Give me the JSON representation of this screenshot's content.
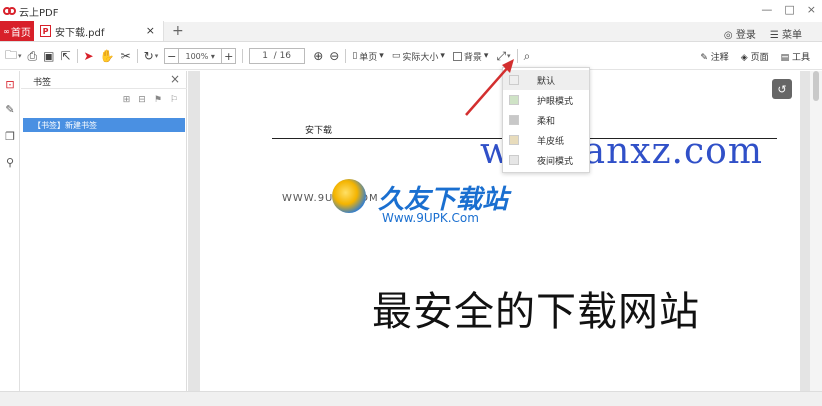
{
  "app": {
    "name": "云上PDF"
  },
  "window": {
    "minimize": "—",
    "maximize": "□",
    "close": "×"
  },
  "tabs": {
    "home_label": "首页",
    "doc_label": "安下载.pdf",
    "doc_close": "×",
    "add": "+"
  },
  "account": {
    "login": "登录",
    "menu": "菜单"
  },
  "toolbar": {
    "zoom_value": "100%",
    "page_current": "1",
    "page_total": "/ 16",
    "single_page": "单页",
    "actual_size": "实际大小",
    "background": "背景",
    "annotate": "注释",
    "page": "页面",
    "tools": "工具"
  },
  "panel": {
    "title": "书签",
    "close": "×",
    "bookmark_item": "【书签】新建书签"
  },
  "document": {
    "header_text": "安下载",
    "url_text": "www.anxz.com",
    "watermark_small": "WWW.9UPK.COM",
    "watermark_big": "久友下载站",
    "watermark_sub": "Www.9UPK.Com",
    "main_text": "最安全的下载网站"
  },
  "background_menu": {
    "items": [
      {
        "label": "默认",
        "color": "#ffffff",
        "selected": true
      },
      {
        "label": "护眼模式",
        "color": "#cfe3c6",
        "selected": false
      },
      {
        "label": "柔和",
        "color": "#c8c8c8",
        "selected": false
      },
      {
        "label": "羊皮纸",
        "color": "#e8dcbc",
        "selected": false
      },
      {
        "label": "夜间模式",
        "color": "#e6e6e6",
        "selected": false
      }
    ]
  },
  "colors": {
    "accent": "#d8202a",
    "selection": "#4a90e2",
    "annotation_arrow": "#d32f2f"
  }
}
